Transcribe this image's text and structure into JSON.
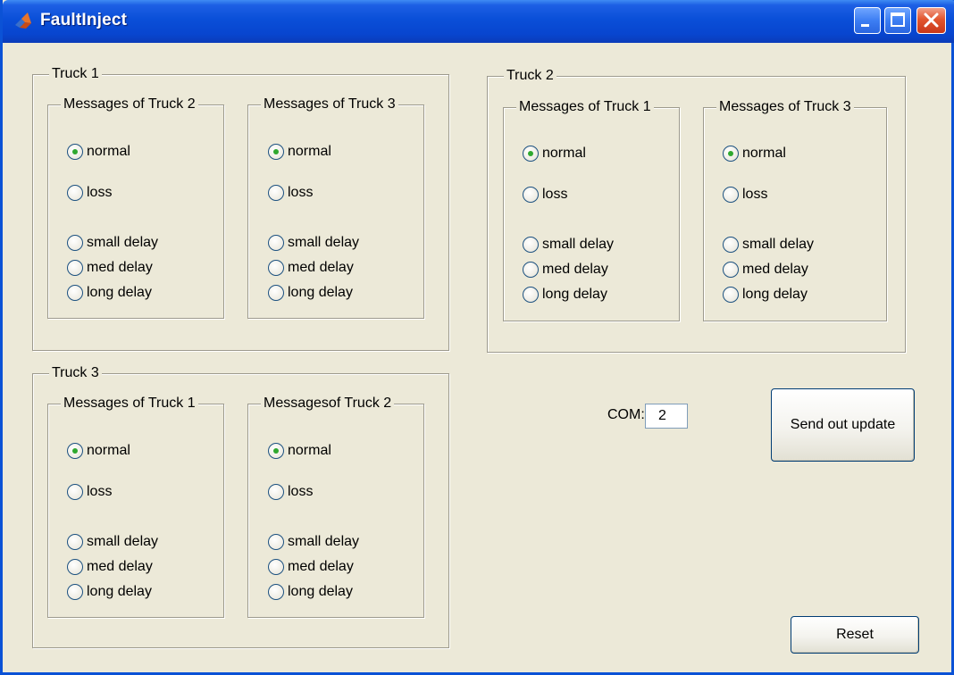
{
  "window": {
    "title": "FaultInject"
  },
  "trucks": [
    {
      "label": "Truck 1",
      "groups": [
        {
          "label": "Messages of Truck 2",
          "options": [
            "normal",
            "loss",
            "small delay",
            "med delay",
            "long delay"
          ],
          "selected": 0
        },
        {
          "label": "Messages of Truck 3",
          "options": [
            "normal",
            "loss",
            "small delay",
            "med delay",
            "long delay"
          ],
          "selected": 0
        }
      ]
    },
    {
      "label": "Truck 2",
      "groups": [
        {
          "label": "Messages of Truck 1",
          "options": [
            "normal",
            "loss",
            "small delay",
            "med delay",
            "long delay"
          ],
          "selected": 0
        },
        {
          "label": "Messages of Truck 3",
          "options": [
            "normal",
            "loss",
            "small delay",
            "med delay",
            "long delay"
          ],
          "selected": 0
        }
      ]
    },
    {
      "label": "Truck 3",
      "groups": [
        {
          "label": "Messages of Truck 1",
          "options": [
            "normal",
            "loss",
            "small delay",
            "med delay",
            "long delay"
          ],
          "selected": 0
        },
        {
          "label": "Messagesof Truck 2",
          "options": [
            "normal",
            "loss",
            "small delay",
            "med delay",
            "long delay"
          ],
          "selected": 0
        }
      ]
    }
  ],
  "com": {
    "label": "COM:",
    "value": "2"
  },
  "buttons": {
    "send": "Send out update",
    "reset": "Reset"
  },
  "colors": {
    "titlebar": "#0a4fd8",
    "face": "#ece9d8",
    "radio_dot": "#2fa82f"
  }
}
